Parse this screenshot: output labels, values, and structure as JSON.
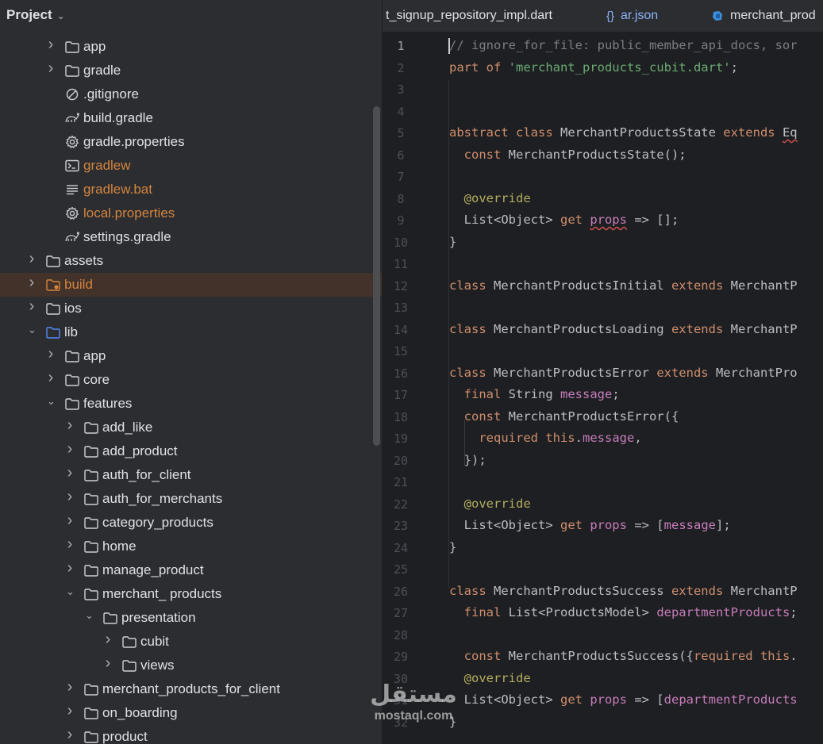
{
  "project_panel": {
    "title": "Project",
    "tree": [
      {
        "label": "app",
        "icon": "folder-icon",
        "chevron": "collapsed"
      },
      {
        "label": "gradle",
        "icon": "folder-icon",
        "chevron": "collapsed"
      },
      {
        "label": ".gitignore",
        "icon": "ignore-file-icon",
        "chevron": "none"
      },
      {
        "label": "build.gradle",
        "icon": "gradle-icon",
        "chevron": "none"
      },
      {
        "label": "gradle.properties",
        "icon": "settings-gear-icon",
        "chevron": "none"
      },
      {
        "label": "gradlew",
        "icon": "terminal-file-icon",
        "chevron": "none",
        "color": "orange"
      },
      {
        "label": "gradlew.bat",
        "icon": "text-file-icon",
        "chevron": "none",
        "color": "orange"
      },
      {
        "label": "local.properties",
        "icon": "settings-gear-icon",
        "chevron": "none",
        "color": "orange"
      },
      {
        "label": "settings.gradle",
        "icon": "gradle-icon",
        "chevron": "none"
      },
      {
        "label": "assets",
        "icon": "folder-icon",
        "chevron": "collapsed"
      },
      {
        "label": "build",
        "icon": "excluded-folder-icon",
        "chevron": "collapsed",
        "color": "orange",
        "selected": true
      },
      {
        "label": "ios",
        "icon": "folder-icon",
        "chevron": "collapsed"
      },
      {
        "label": "lib",
        "icon": "source-folder-icon",
        "chevron": "expanded"
      },
      {
        "label": "app",
        "icon": "folder-icon",
        "chevron": "collapsed"
      },
      {
        "label": "core",
        "icon": "folder-icon",
        "chevron": "collapsed"
      },
      {
        "label": "features",
        "icon": "folder-icon",
        "chevron": "expanded"
      },
      {
        "label": "add_like",
        "icon": "folder-icon",
        "chevron": "collapsed"
      },
      {
        "label": "add_product",
        "icon": "folder-icon",
        "chevron": "collapsed"
      },
      {
        "label": "auth_for_client",
        "icon": "folder-icon",
        "chevron": "collapsed"
      },
      {
        "label": "auth_for_merchants",
        "icon": "folder-icon",
        "chevron": "collapsed"
      },
      {
        "label": "category_products",
        "icon": "folder-icon",
        "chevron": "collapsed"
      },
      {
        "label": "home",
        "icon": "folder-icon",
        "chevron": "collapsed"
      },
      {
        "label": "manage_product",
        "icon": "folder-icon",
        "chevron": "collapsed"
      },
      {
        "label": "merchant_ products",
        "icon": "folder-icon",
        "chevron": "expanded"
      },
      {
        "label": "presentation",
        "icon": "folder-icon",
        "chevron": "expanded"
      },
      {
        "label": "cubit",
        "icon": "folder-icon",
        "chevron": "collapsed"
      },
      {
        "label": "views",
        "icon": "folder-icon",
        "chevron": "collapsed"
      },
      {
        "label": "merchant_products_for_client",
        "icon": "folder-icon",
        "chevron": "collapsed"
      },
      {
        "label": "on_boarding",
        "icon": "folder-icon",
        "chevron": "collapsed"
      },
      {
        "label": "product",
        "icon": "folder-icon",
        "chevron": "collapsed"
      }
    ]
  },
  "tabs": [
    {
      "label": "t_signup_repository_impl.dart",
      "icon": "",
      "type": "dart"
    },
    {
      "label": "ar.json",
      "icon": "json-braces-icon",
      "type": "json"
    },
    {
      "label": "merchant_prod",
      "icon": "dart-icon",
      "type": "dart"
    }
  ],
  "editor": {
    "current_line": 1,
    "lines": [
      {
        "n": "1",
        "tokens": [
          [
            "cmt",
            "// ignore_for_file: public_member_api_docs, sor"
          ]
        ]
      },
      {
        "n": "2",
        "tokens": [
          [
            "kw",
            "part of "
          ],
          [
            "str",
            "'merchant_products_cubit.dart'"
          ],
          [
            "",
            ";"
          ]
        ]
      },
      {
        "n": "3",
        "tokens": []
      },
      {
        "n": "4",
        "tokens": []
      },
      {
        "n": "5",
        "tokens": [
          [
            "kw",
            "abstract class "
          ],
          [
            "",
            "MerchantProductsState "
          ],
          [
            "kw",
            "extends "
          ],
          [
            "ul",
            "Eq"
          ]
        ]
      },
      {
        "n": "6",
        "tokens": [
          [
            "",
            "  "
          ],
          [
            "kw",
            "const "
          ],
          [
            "",
            "MerchantProductsState();"
          ]
        ]
      },
      {
        "n": "7",
        "tokens": []
      },
      {
        "n": "8",
        "tokens": [
          [
            "",
            "  "
          ],
          [
            "ann",
            "@override"
          ]
        ]
      },
      {
        "n": "9",
        "tokens": [
          [
            "",
            "  List<Object> "
          ],
          [
            "kw",
            "get "
          ],
          [
            "fldul",
            "props"
          ],
          [
            "",
            " => [];"
          ]
        ]
      },
      {
        "n": "10",
        "tokens": [
          [
            "",
            "}"
          ]
        ]
      },
      {
        "n": "11",
        "tokens": []
      },
      {
        "n": "12",
        "tokens": [
          [
            "kw",
            "class "
          ],
          [
            "",
            "MerchantProductsInitial "
          ],
          [
            "kw",
            "extends "
          ],
          [
            "",
            "MerchantP"
          ]
        ]
      },
      {
        "n": "13",
        "tokens": []
      },
      {
        "n": "14",
        "tokens": [
          [
            "kw",
            "class "
          ],
          [
            "",
            "MerchantProductsLoading "
          ],
          [
            "kw",
            "extends "
          ],
          [
            "",
            "MerchantP"
          ]
        ]
      },
      {
        "n": "15",
        "tokens": []
      },
      {
        "n": "16",
        "tokens": [
          [
            "kw",
            "class "
          ],
          [
            "",
            "MerchantProductsError "
          ],
          [
            "kw",
            "extends "
          ],
          [
            "",
            "MerchantPro"
          ]
        ]
      },
      {
        "n": "17",
        "tokens": [
          [
            "",
            "  "
          ],
          [
            "kw",
            "final "
          ],
          [
            "",
            "String "
          ],
          [
            "fld",
            "message"
          ],
          [
            "",
            ";"
          ]
        ]
      },
      {
        "n": "18",
        "tokens": [
          [
            "",
            "  "
          ],
          [
            "kw",
            "const "
          ],
          [
            "",
            "MerchantProductsError({"
          ]
        ]
      },
      {
        "n": "19",
        "tokens": [
          [
            "",
            "    "
          ],
          [
            "kw",
            "required this"
          ],
          [
            "",
            "."
          ],
          [
            "fld",
            "message"
          ],
          [
            "",
            ","
          ]
        ]
      },
      {
        "n": "20",
        "tokens": [
          [
            "",
            "  });"
          ]
        ]
      },
      {
        "n": "21",
        "tokens": []
      },
      {
        "n": "22",
        "tokens": [
          [
            "",
            "  "
          ],
          [
            "ann",
            "@override"
          ]
        ]
      },
      {
        "n": "23",
        "tokens": [
          [
            "",
            "  List<Object> "
          ],
          [
            "kw",
            "get "
          ],
          [
            "fld",
            "props"
          ],
          [
            "",
            " => ["
          ],
          [
            "fld",
            "message"
          ],
          [
            "",
            "];"
          ]
        ]
      },
      {
        "n": "24",
        "tokens": [
          [
            "",
            "}"
          ]
        ]
      },
      {
        "n": "25",
        "tokens": []
      },
      {
        "n": "26",
        "tokens": [
          [
            "kw",
            "class "
          ],
          [
            "",
            "MerchantProductsSuccess "
          ],
          [
            "kw",
            "extends "
          ],
          [
            "",
            "MerchantP"
          ]
        ]
      },
      {
        "n": "27",
        "tokens": [
          [
            "",
            "  "
          ],
          [
            "kw",
            "final "
          ],
          [
            "",
            "List<ProductsModel> "
          ],
          [
            "fld",
            "departmentProducts"
          ],
          [
            "",
            ";"
          ]
        ]
      },
      {
        "n": "28",
        "tokens": []
      },
      {
        "n": "29",
        "tokens": [
          [
            "",
            "  "
          ],
          [
            "kw",
            "const "
          ],
          [
            "",
            "MerchantProductsSuccess({"
          ],
          [
            "kw",
            "required this"
          ],
          [
            "",
            "."
          ]
        ]
      },
      {
        "n": "30",
        "tokens": [
          [
            "",
            "  "
          ],
          [
            "ann",
            "@override"
          ]
        ]
      },
      {
        "n": "31",
        "tokens": [
          [
            "",
            "  List<Object> "
          ],
          [
            "kw",
            "get "
          ],
          [
            "fld",
            "props"
          ],
          [
            "",
            " => ["
          ],
          [
            "fld",
            "departmentProducts"
          ]
        ]
      },
      {
        "n": "32",
        "tokens": [
          [
            "",
            "}"
          ]
        ]
      }
    ]
  },
  "watermark": {
    "logo": "مستقل",
    "site": "mostaql.com"
  }
}
